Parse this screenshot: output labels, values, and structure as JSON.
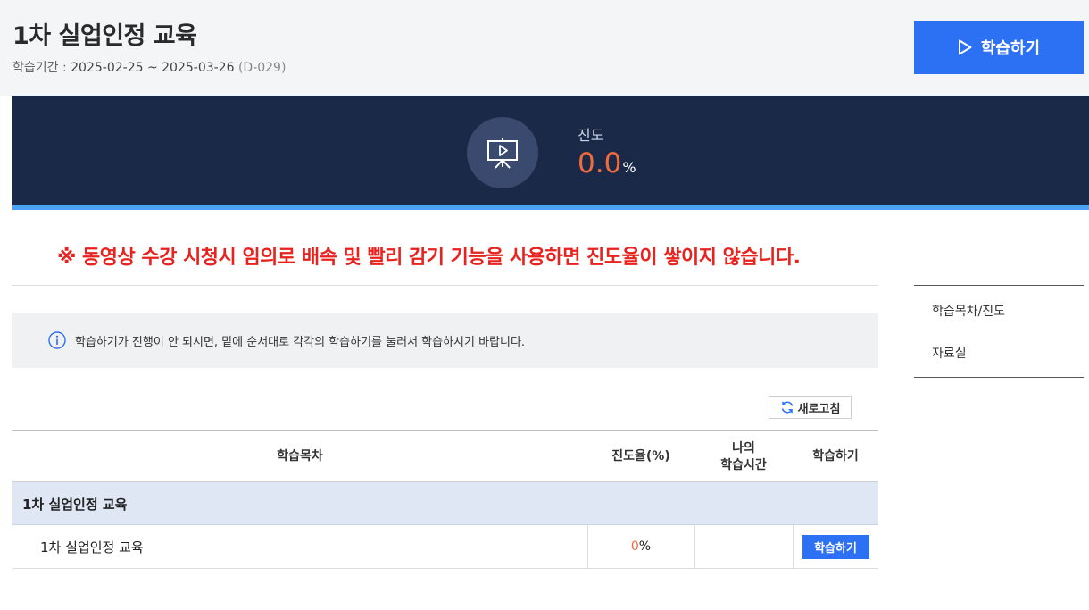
{
  "header": {
    "title": "1차 실업인정 교육",
    "period_label": "학습기간 :",
    "period_value": "2025-02-25 ~ 2025-03-26",
    "dday": "(D-029)",
    "start_button": "학습하기"
  },
  "progress": {
    "label": "진도",
    "value": "0.0",
    "unit": "%",
    "icon": "presentation-icon",
    "value_color": "#f26b3a"
  },
  "warning": "※ 동영상 수강 시청시 임의로 배속 및 빨리 감기 기능을 사용하면 진도율이 쌓이지 않습니다.",
  "info": {
    "icon": "info-icon",
    "text": "학습하기가 진행이 안 되시면, 밑에 순서대로 각각의 학습하기를 눌러서 학습하시기 바랍니다."
  },
  "refresh_button": "새로고침",
  "table": {
    "columns": [
      "학습목차",
      "진도율(%)",
      "나의\n학습시간",
      "학습하기"
    ],
    "col_myTime_line1": "나의",
    "col_myTime_line2": "학습시간",
    "group": "1차 실업인정 교육",
    "rows": [
      {
        "title": "1차 실업인정 교육",
        "progress": "0",
        "progress_unit": "%",
        "my_time": "",
        "action": "학습하기"
      }
    ]
  },
  "side_menu": {
    "items": [
      "학습목차/진도",
      "자료실"
    ]
  },
  "colors": {
    "primary": "#2c70f4",
    "band": "#1b2949",
    "accent_line": "#4aa3f5",
    "warning": "#e8231f"
  }
}
